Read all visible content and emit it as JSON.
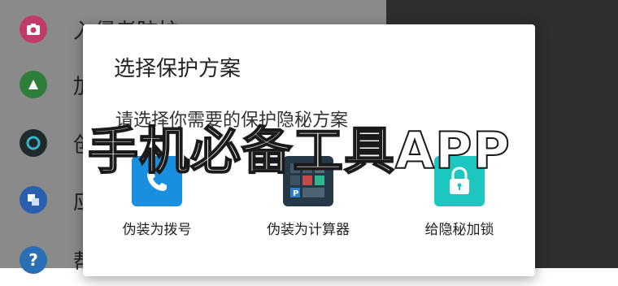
{
  "drawer": {
    "items": [
      {
        "label": "入侵者防护",
        "icon": "camera-icon",
        "color": "#c23a6a"
      },
      {
        "label": "加",
        "icon": "rocket-icon",
        "color": "#2f7d3a"
      },
      {
        "label": "创",
        "icon": "lens-icon",
        "color": "#1f2a2c"
      },
      {
        "label": "应",
        "icon": "windows-icon",
        "color": "#2a5fb0"
      },
      {
        "label": "帮",
        "icon": "help-icon",
        "color": "#2a6fb5"
      }
    ]
  },
  "dialog": {
    "title": "选择保护方案",
    "subtitle": "请选择你需要的保护隐秘方案",
    "options": [
      {
        "label": "伪装为拨号",
        "icon": "phone-icon",
        "color": "#1a8fe0"
      },
      {
        "label": "伪装为计算器",
        "icon": "calculator-icon",
        "color": "#253846"
      },
      {
        "label": "给隐秘加锁",
        "icon": "lock-icon",
        "color": "#1dc7bf"
      }
    ]
  },
  "watermark": {
    "text": "手机必备工具APP"
  }
}
